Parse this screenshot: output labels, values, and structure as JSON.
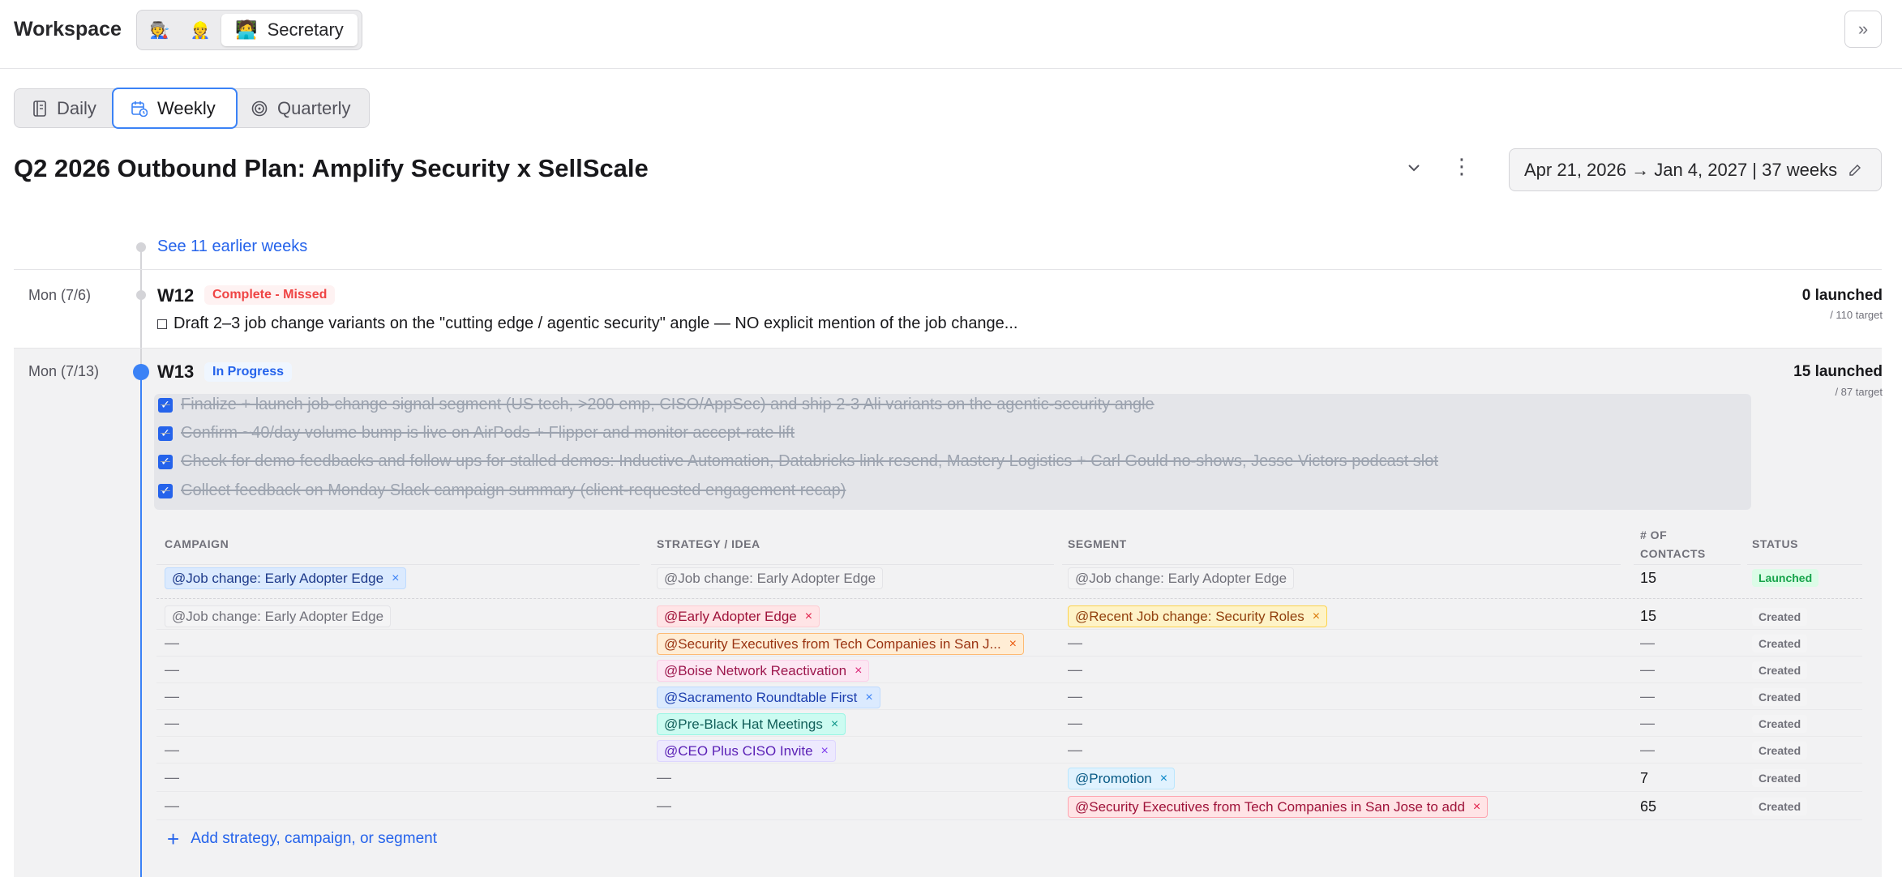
{
  "header": {
    "title": "Workspace",
    "personas": [
      "🧑‍🏭",
      "👷",
      "🧑‍💻"
    ],
    "active_persona_label": "Secretary"
  },
  "tabs": [
    {
      "label": "Daily",
      "icon": "notebook-icon"
    },
    {
      "label": "Weekly",
      "icon": "calendar-clock-icon",
      "active": true
    },
    {
      "label": "Quarterly",
      "icon": "target-icon"
    }
  ],
  "plan": {
    "title": "Q2 2026 Outbound Plan: Amplify Security x SellScale",
    "date_range": "Apr 21, 2026 → Jan 4, 2027 | 37 weeks"
  },
  "earlier_link": "See 11 earlier weeks",
  "weeks": [
    {
      "date": "Mon (7/6)",
      "label": "W12",
      "status": "Complete - Missed",
      "launched": "0 launched",
      "target": "/ 110 target",
      "task": "Draft 2–3 job change variants on the \"cutting edge / agentic security\" angle — NO explicit mention of the job change..."
    },
    {
      "date": "Mon (7/13)",
      "label": "W13",
      "status": "In Progress",
      "launched": "15 launched",
      "target": "/ 87 target",
      "tasks": [
        "Finalize + launch job-change signal segment (US tech, >200 emp, CISO/AppSec) and ship 2-3 Ali variants on the agentic-security angle",
        "Confirm ~40/day volume bump is live on AirPods + Flipper and monitor accept-rate lift",
        "Check for demo feedbacks and follow ups for stalled demos: Inductive Automation, Databricks link resend, Mastery Logistics + Carl Gould no-shows, Jesse Victors podcast slot",
        "Collect feedback on Monday Slack campaign summary (client-requested engagement recap)"
      ]
    }
  ],
  "table": {
    "headers": {
      "campaign": "CAMPAIGN",
      "strategy": "STRATEGY / IDEA",
      "segment": "SEGMENT",
      "contacts_1": "# OF",
      "contacts_2": "CONTACTS",
      "status": "STATUS"
    },
    "dash": "—",
    "rows": [
      {
        "campaign": "@Job change: Early Adopter Edge",
        "strategy": "@Job change: Early Adopter Edge",
        "segment": "@Job change: Early Adopter Edge",
        "contacts": "15",
        "status": "Launched"
      },
      {
        "campaign": "@Job change: Early Adopter Edge",
        "strategy": "@Early Adopter Edge",
        "segment": "@Recent Job change: Security Roles",
        "contacts": "15",
        "status": "Created"
      },
      {
        "campaign": "—",
        "strategy": "@Security Executives from Tech Companies in San J...",
        "segment": "—",
        "contacts": "—",
        "status": "Created"
      },
      {
        "campaign": "—",
        "strategy": "@Boise Network Reactivation",
        "segment": "—",
        "contacts": "—",
        "status": "Created"
      },
      {
        "campaign": "—",
        "strategy": "@Sacramento Roundtable First",
        "segment": "—",
        "contacts": "—",
        "status": "Created"
      },
      {
        "campaign": "—",
        "strategy": "@Pre-Black Hat Meetings",
        "segment": "—",
        "contacts": "—",
        "status": "Created"
      },
      {
        "campaign": "—",
        "strategy": "@CEO Plus CISO Invite",
        "segment": "—",
        "contacts": "—",
        "status": "Created"
      },
      {
        "campaign": "—",
        "strategy": "—",
        "segment": "@Promotion",
        "contacts": "7",
        "status": "Created"
      },
      {
        "campaign": "—",
        "strategy": "—",
        "segment": "@Security Executives from Tech Companies in San Jose to add",
        "contacts": "65",
        "status": "Created"
      }
    ],
    "remove_glyph": "×",
    "add_label": "Add strategy, campaign, or segment"
  },
  "colors": {
    "accent": "#2563eb",
    "missed": "#ef4444",
    "launched_status": "#16a34a"
  }
}
